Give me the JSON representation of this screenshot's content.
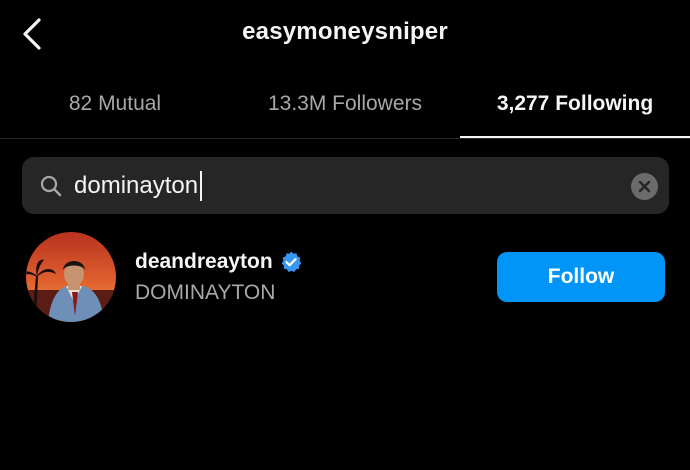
{
  "header": {
    "title": "easymoneysniper",
    "back_icon": "chevron-left-icon"
  },
  "tabs": [
    {
      "label": "82 Mutual",
      "active": false
    },
    {
      "label": "13.3M Followers",
      "active": false
    },
    {
      "label": "3,277 Following",
      "active": true
    }
  ],
  "search": {
    "value": "dominayton",
    "icon": "search-icon",
    "clear_icon": "clear-icon"
  },
  "results": [
    {
      "username": "deandreayton",
      "verified": true,
      "full_name": "DOMINAYTON",
      "follow_label": "Follow"
    }
  ],
  "colors": {
    "background": "#000000",
    "primary_text": "#f5f5f5",
    "secondary_text": "#a8a8a8",
    "search_bg": "#262626",
    "follow_button": "#0095f6",
    "verified_badge": "#3797f0"
  }
}
